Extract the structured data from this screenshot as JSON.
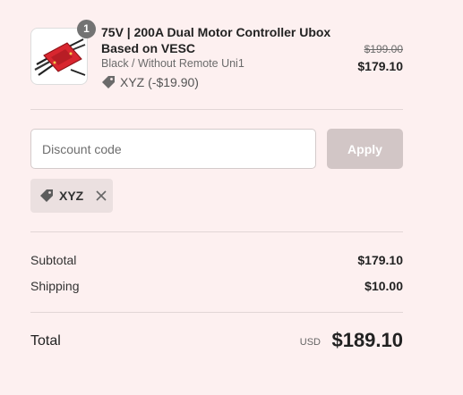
{
  "product": {
    "quantity": "1",
    "title": "75V | 200A Dual Motor Controller Ubox Based on VESC",
    "variant": "Black / Without Remote Uni1",
    "discount_text": "XYZ (-$19.90)",
    "original_price": "$199.00",
    "price": "$179.10",
    "image_icon": "motor-controller-image"
  },
  "discount": {
    "placeholder": "Discount code",
    "value": "",
    "apply_label": "Apply",
    "applied_code": "XYZ"
  },
  "summary": {
    "subtotal_label": "Subtotal",
    "subtotal_value": "$179.10",
    "shipping_label": "Shipping",
    "shipping_value": "$10.00",
    "total_label": "Total",
    "currency": "USD",
    "total_value": "$189.10"
  },
  "colors": {
    "background": "#fdf0f0",
    "apply_button": "#d2c6c6",
    "chip_background": "#ebe0e0",
    "badge": "#737373",
    "product_board": "#d8262f"
  }
}
